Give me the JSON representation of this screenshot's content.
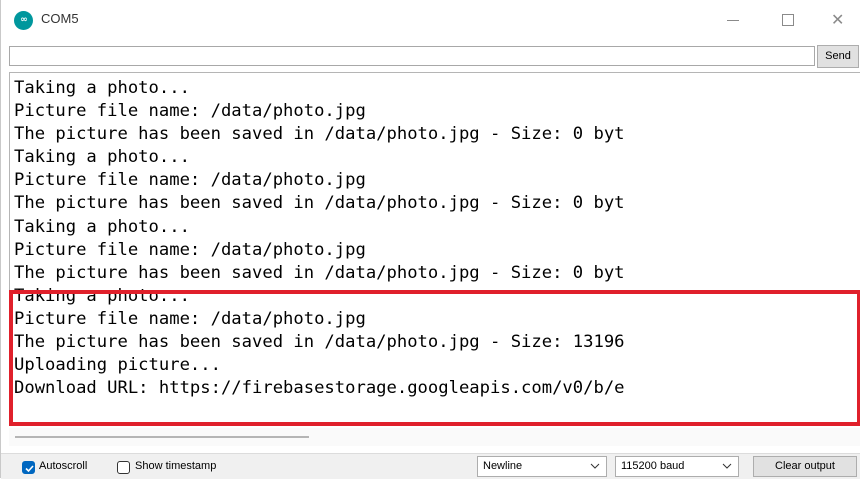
{
  "window": {
    "title": "COM5",
    "app_icon": "arduino-icon",
    "icon_text": "∞",
    "controls": {
      "minimize": "minimize-icon",
      "maximize": "maximize-icon",
      "close": "close-icon",
      "close_glyph": "✕"
    }
  },
  "input_bar": {
    "value": "",
    "send_label": "Send"
  },
  "console": {
    "lines": [
      "Taking a photo...",
      "Picture file name: /data/photo.jpg",
      "The picture has been saved in /data/photo.jpg - Size: 0 byt",
      "Taking a photo...",
      "Picture file name: /data/photo.jpg",
      "The picture has been saved in /data/photo.jpg - Size: 0 byt",
      "Taking a photo...",
      "Picture file name: /data/photo.jpg",
      "The picture has been saved in /data/photo.jpg - Size: 0 byt",
      "Taking a photo...",
      "Picture file name: /data/photo.jpg",
      "The picture has been saved in /data/photo.jpg - Size: 13196",
      "Uploading picture...",
      "Download URL: https://firebasestorage.googleapis.com/v0/b/e"
    ],
    "highlight_color": "#e0202b"
  },
  "statusbar": {
    "autoscroll_label": "Autoscroll",
    "autoscroll_checked": true,
    "timestamp_label": "Show timestamp",
    "timestamp_checked": false,
    "line_ending": "Newline",
    "baud_rate": "115200 baud",
    "clear_label": "Clear output",
    "accent_color": "#0067c0"
  }
}
